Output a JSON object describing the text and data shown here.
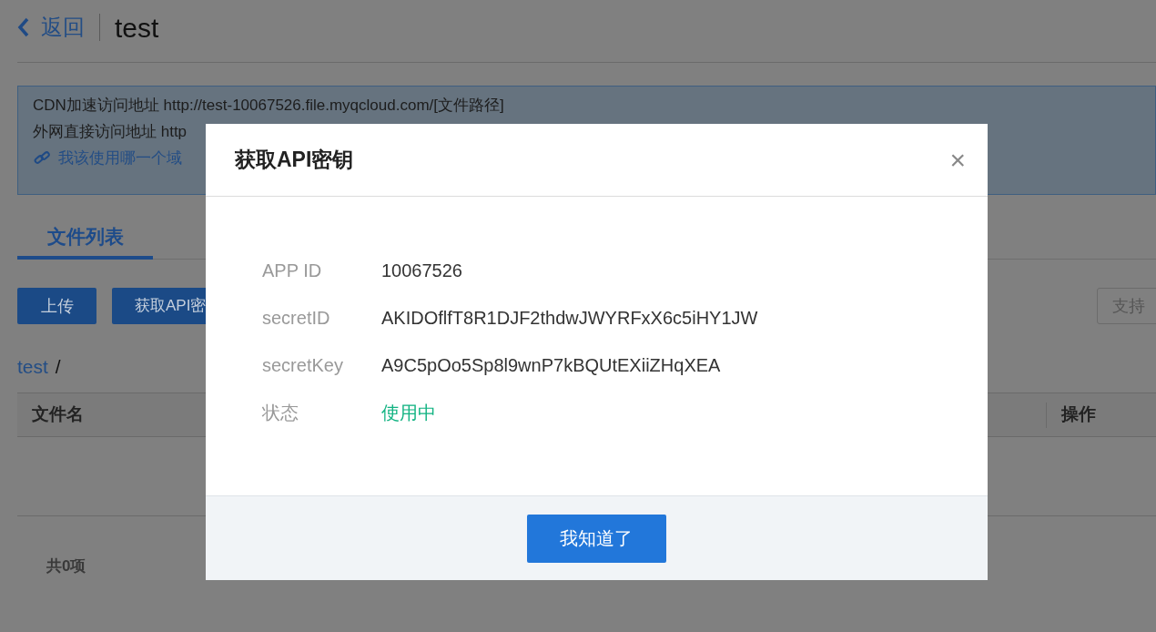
{
  "header": {
    "back_label": "返回",
    "title": "test"
  },
  "info_box": {
    "lines": [
      "CDN加速访问地址 http://test-10067526.file.myqcloud.com/[文件路径]",
      "外网直接访问地址 http"
    ],
    "link": "我该使用哪一个域"
  },
  "tabs": [
    {
      "label": "文件列表",
      "selected": true
    }
  ],
  "toolbar": {
    "buttons": [
      "上传",
      "获取API密"
    ],
    "right_button": "支持"
  },
  "breadcrumb": {
    "path": "test",
    "separator": "/"
  },
  "table": {
    "columns": [
      "文件名",
      "操作"
    ]
  },
  "footer": {
    "count": "共0项"
  },
  "dialog": {
    "title": "获取API密钥",
    "close": "×",
    "fields": [
      {
        "label": "APP ID",
        "value": "10067526",
        "kind": "text"
      },
      {
        "label": "secretID",
        "value": "AKIDOflfT8R1DJF2thdwJWYRFxX6c5iHY1JW",
        "kind": "text"
      },
      {
        "label": "secretKey",
        "value": "A9C5pOo5Sp8l9wnP7kBQUtEXiiZHqXEA",
        "kind": "text"
      },
      {
        "label": "状态",
        "value": "使用中",
        "kind": "status"
      }
    ],
    "button": "我知道了"
  }
}
